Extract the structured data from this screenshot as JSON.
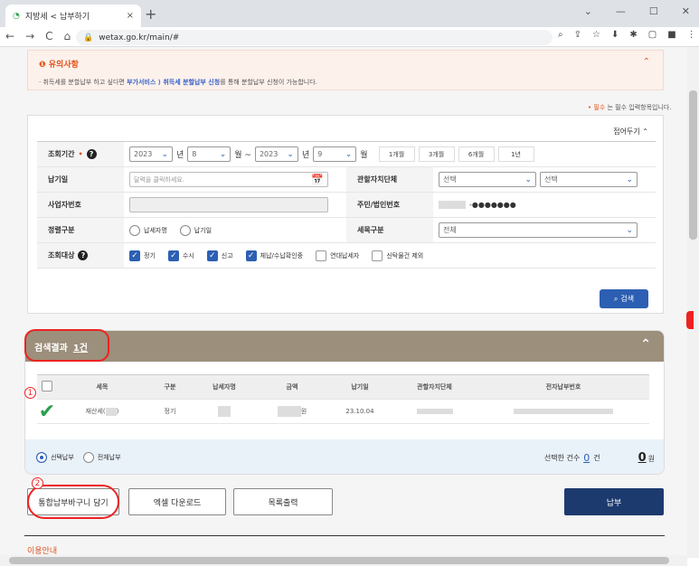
{
  "browser": {
    "tab_title": "지방세 < 납부하기",
    "url": "wetax.go.kr/main/#",
    "new_tab": "+",
    "close": "×",
    "minimize": "—",
    "maximize": "☐",
    "win_close": "✕",
    "back": "←",
    "forward": "→",
    "reload": "C",
    "home": "⌂"
  },
  "notice": {
    "title": "유의사항",
    "text_pre": "· 취득세를 분할납부 하고 싶다면 ",
    "link": "부가서비스 ⟩ 취득세 분할납부 신청",
    "text_post": "를 통해 분할납부 신청이 가능합니다."
  },
  "required_note": {
    "mark": "•",
    "text": "는 필수 입력항목입니다."
  },
  "required_red": "필수",
  "form": {
    "fold_label": "접어두기",
    "period_label": "조회기간",
    "period": {
      "start_year": "2023",
      "start_month": "8",
      "end_year": "2023",
      "end_month": "9",
      "year_unit": "년",
      "month_unit": "월",
      "tilde": "월 ~"
    },
    "quick": [
      "1개월",
      "3개월",
      "6개월",
      "1년"
    ],
    "due_label": "납기일",
    "due_placeholder": "달력을 클릭하세요.",
    "office_label": "관할자치단체",
    "office_sel1": "선택",
    "office_sel2": "선택",
    "bizno_label": "사업자번호",
    "rrn_label": "주민/법인번호",
    "rrn_mask": "-●●●●●●●",
    "sort_label": "정렬구분",
    "sort_opt1": "납세자명",
    "sort_opt2": "납기일",
    "tax_label": "세목구분",
    "tax_sel": "전체",
    "target_label": "조회대상",
    "targets": [
      "정기",
      "수시",
      "신고",
      "체납/수납확인중",
      "연대납세자",
      "신탁물건 제외"
    ],
    "search_label": "검색"
  },
  "results": {
    "title": "검색결과",
    "count": "1건",
    "columns": [
      "세목",
      "구분",
      "납세자명",
      "금액",
      "납기일",
      "관할자치단체",
      "전자납부번호"
    ],
    "rows": [
      {
        "tax": "재산세(",
        "type": "정기",
        "amount_unit": "원",
        "due": "23.10.04"
      }
    ],
    "pay_opt1": "선택납부",
    "pay_opt2": "전체납부",
    "selected_label": "선택한 건수",
    "selected_count": "0",
    "selected_unit": "건",
    "total": "0",
    "total_unit": "원"
  },
  "buttons": {
    "cart": "통합납부바구니 담기",
    "excel": "엑셀 다운로드",
    "print": "목록출력",
    "pay": "납부"
  },
  "marks": {
    "one": "1",
    "two": "2"
  },
  "guide_label": "이용안내"
}
